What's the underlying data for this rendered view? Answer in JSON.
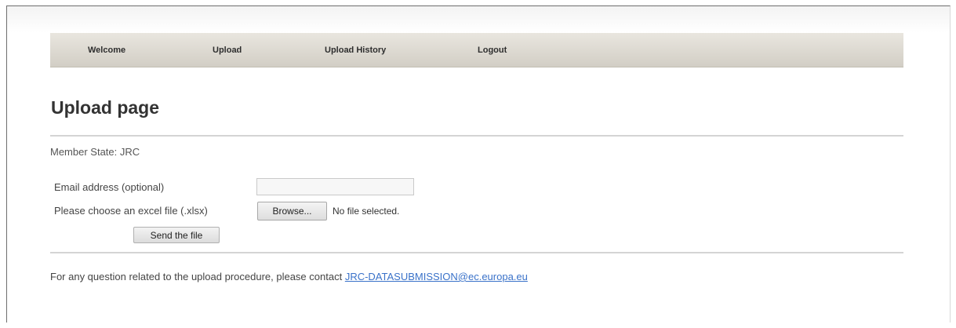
{
  "nav": {
    "items": [
      {
        "label": "Welcome"
      },
      {
        "label": "Upload"
      },
      {
        "label": "Upload History"
      },
      {
        "label": "Logout"
      }
    ]
  },
  "page": {
    "title": "Upload page",
    "member_state": "Member State: JRC"
  },
  "form": {
    "email_label": "Email address (optional)",
    "email_value": "",
    "file_label": "Please choose an excel file (.xlsx)",
    "browse_label": "Browse...",
    "file_status": "No file selected.",
    "send_label": "Send the file"
  },
  "contact": {
    "text": "For any question related to the upload procedure, please contact ",
    "email": "JRC-DATASUBMISSION@ec.europa.eu"
  }
}
